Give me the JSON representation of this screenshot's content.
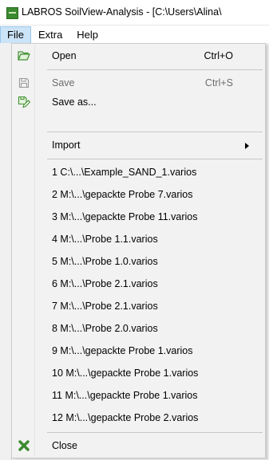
{
  "window": {
    "title": "LABROS SoilView-Analysis - [C:\\Users\\Alina\\"
  },
  "menubar": [
    {
      "label": "File",
      "active": true
    },
    {
      "label": "Extra",
      "active": false
    },
    {
      "label": "Help",
      "active": false
    }
  ],
  "file_menu": {
    "open": {
      "label": "Open",
      "shortcut": "Ctrl+O"
    },
    "save": {
      "label": "Save",
      "shortcut": "Ctrl+S"
    },
    "save_as": {
      "label": "Save as..."
    },
    "import": {
      "label": "Import"
    },
    "recent": [
      "1 C:\\...\\Example_SAND_1.varios",
      "2 M:\\...\\gepackte Probe 7.varios",
      "3 M:\\...\\gepackte Probe 11.varios",
      "4 M:\\...\\Probe 1.1.varios",
      "5 M:\\...\\Probe 1.0.varios",
      "6 M:\\...\\Probe 2.1.varios",
      "7 M:\\...\\Probe 2.1.varios",
      "8 M:\\...\\Probe 2.0.varios",
      "9 M:\\...\\gepackte Probe 1.varios",
      "10 M:\\...\\gepackte Probe 1.varios",
      "11 M:\\...\\gepackte Probe 1.varios",
      "12 M:\\...\\gepackte Probe 2.varios"
    ],
    "close": {
      "label": "Close"
    }
  },
  "colors": {
    "menu_highlight": "#cce4f7",
    "close_icon": "#3a8a2e",
    "open_icon": "#3f8f2f",
    "disabled_text": "#6d6d6d"
  },
  "icons": {
    "open": "folder-open-icon",
    "save": "floppy-disk-icon",
    "save_as": "floppy-disk-edit-icon",
    "close": "green-x-icon",
    "submenu": "chevron-right-icon"
  }
}
